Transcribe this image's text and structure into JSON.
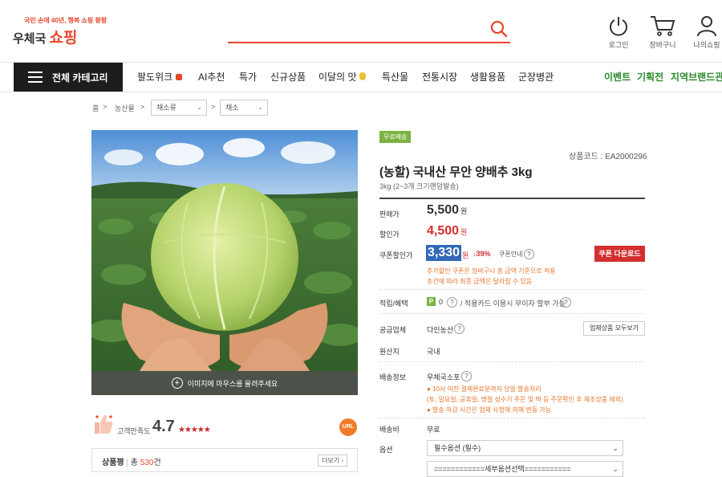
{
  "header": {
    "logo_tagline": "국민 손에 40년, 행복 쇼핑 팡팡",
    "logo_tag_num": "40",
    "logo_name": "우체국",
    "logo_name_accent": "쇼핑",
    "search": {
      "placeholder": "",
      "icon": "search-icon"
    },
    "icons": [
      {
        "label": "로그인",
        "icon": "power-icon"
      },
      {
        "label": "장바구니",
        "icon": "cart-icon"
      },
      {
        "label": "나의쇼핑",
        "icon": "user-icon"
      }
    ]
  },
  "nav": {
    "category_button": "전체 카테고리",
    "items": [
      "팔도위크",
      "AI추천",
      "특가",
      "신규상품",
      "이달의 맛",
      "특산물",
      "전통시장",
      "생활용품",
      "군장병관"
    ],
    "right_items": [
      "이벤트",
      "기획전",
      "지역브랜드관"
    ]
  },
  "breadcrumb": {
    "home": "홈",
    "level1": "농산물",
    "select1": "채소류",
    "select2": "채소"
  },
  "gallery": {
    "hover_hint": "이미지에 마우스를 올려주세요"
  },
  "rating": {
    "label": "고객만족도",
    "value": "4.7",
    "stars": "★★★★★",
    "url_badge": "URL"
  },
  "reviews": {
    "label": "상품평",
    "total_prefix": "총",
    "count": "530",
    "suffix": "건",
    "more": "더보기"
  },
  "product": {
    "badge": "무료배송",
    "code": "상품코드 : EA2000296",
    "title": "(농할) 국내산 무안 양배추 3kg",
    "subtitle": "3kg (2~3개 크기랜덤발송)",
    "price_label": "판매가",
    "price": "5,500",
    "won": "원",
    "discount_label": "할인가",
    "discount_price": "4,500",
    "coupon_label": "쿠폰할인가",
    "coupon_price": "3,330",
    "coupon_pct": "↓39%",
    "coupon_info": "쿠폰안내",
    "coupon_button": "쿠폰 다운로드",
    "coupon_note1": "추가할인 쿠폰은 장바구니 총 금액 기준으로 적용",
    "coupon_note2": "조건에 따라 최종 금액은 달라질 수 있음",
    "points_label": "적립/혜택",
    "points_value": "0",
    "points_extra": "/ 적용카드 이용시 무이자 할부 가능",
    "supplier_label": "공급업체",
    "supplier": "다인농산",
    "supplier_button": "업체상품 모두보기",
    "origin_label": "원산지",
    "origin": "국내",
    "delivery_label": "배송정보",
    "delivery_company": "우체국소포",
    "delivery_notes": [
      "● 10시 이전 결제완료분까지 당일 발송처리",
      "(토, 일요일, 공휴일, 명절 성수기 주문 및 택 등 주문확인 후 제조상품 제외)",
      "● 발송 마감 시간은 업체 사정에 의해 변동 가능"
    ],
    "shipping_fee_label": "배송비",
    "shipping_fee": "무료",
    "option_label": "옵션",
    "option_select1": "필수옵션 (필수)",
    "option_select2": "============세부옵션선택==========="
  },
  "colors": {
    "accent": "#e8472b",
    "green": "#2b8a2b",
    "coupon_highlight": "#3268b8"
  }
}
